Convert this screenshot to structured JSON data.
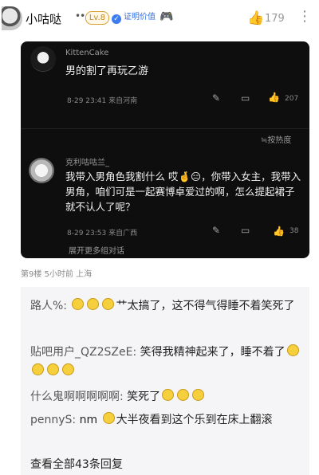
{
  "header": {
    "username": "小咕哒",
    "dots": "•••",
    "level": "Lv.8",
    "badge_label": "证明价值",
    "badge_icon": "shield-check-icon",
    "game_icon": "gamepad-icon",
    "like_icon": "thumbs-up-icon",
    "like_count": "179",
    "more_icon": "vertical-dots-icon"
  },
  "card": {
    "comment1": {
      "name": "KittenCake",
      "text": "男的割了再玩乙游",
      "time_location": "8-29 23:41  来自河南",
      "edit_icon": "edit-icon",
      "reply_icon": "reply-icon",
      "like_icon": "thumbs-up-icon",
      "like_count": "207"
    },
    "sort_label": "≒按热度",
    "comment2": {
      "name": "克利咕咕兰_",
      "text": "我带入男角色我割什么 哎🤞😑，你带入女主，我带入男角，咱们可是一起赛博卓爱过的啊，怎么提起裙子就不认人了呢？",
      "time_location": "8-29 23:53  来自广西",
      "edit_icon": "edit-icon",
      "reply_icon": "reply-icon",
      "like_icon": "fire-thumbs-up-icon",
      "like_count": "38"
    },
    "expand_label": "展开更多组对话"
  },
  "post_meta": "第9楼  5小时前  上海",
  "replies": [
    {
      "nick": "路人%:",
      "pre_emoji": 3,
      "text": "艹太搞了，这不得气得睡不着笑死了"
    },
    {
      "nick": "贴吧用户_QZ2SZeE:",
      "pre_emoji": 0,
      "text": "笑得我精神起来了，睡不着了"
    },
    {
      "nick": "什么鬼啊啊啊啊啊:",
      "pre_emoji": 0,
      "text": "笑死了"
    },
    {
      "nick": "pennyS:",
      "pre_emoji": 0,
      "text": "nm"
    },
    {
      "tail": "大半夜看到这个乐到在床上翻滚"
    }
  ],
  "view_all": "查看全部43条回复"
}
